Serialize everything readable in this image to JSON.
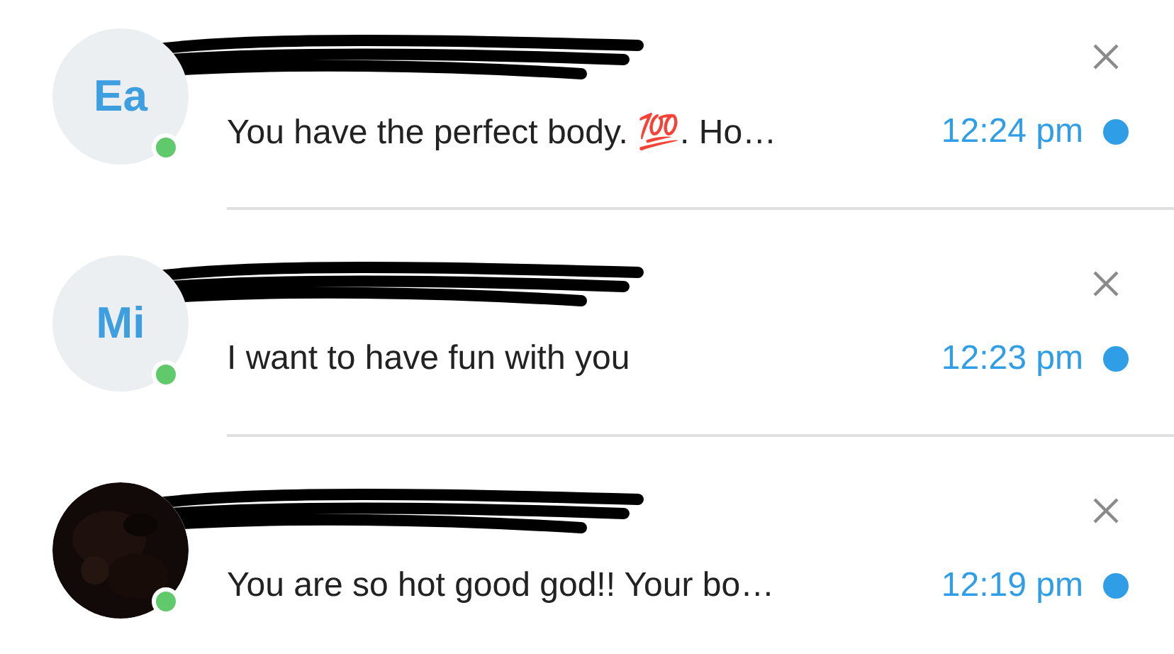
{
  "conversations": [
    {
      "avatar": {
        "kind": "initials",
        "text": "Ea"
      },
      "online": true,
      "message": "You have the perfect body. 💯. Ho…",
      "time": "12:24 pm",
      "unread": true
    },
    {
      "avatar": {
        "kind": "initials",
        "text": "Mi"
      },
      "online": true,
      "message": "I want to have fun with you",
      "time": "12:23 pm",
      "unread": true
    },
    {
      "online": true,
      "message": "You are so hot good god!! Your bo…",
      "time": "12:19 pm",
      "unread": true
    }
  ]
}
